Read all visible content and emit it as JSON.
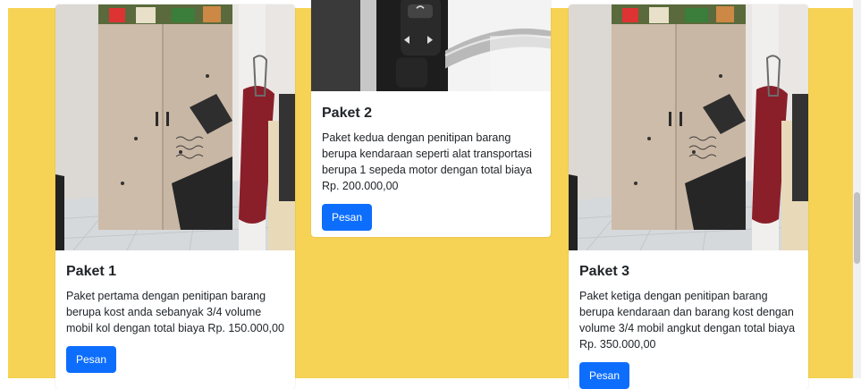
{
  "cards": [
    {
      "title": "Paket 1",
      "text": "Paket pertama dengan penitipan barang berupa kost anda sebanyak 3/4 volume mobil kol dengan total biaya Rp. 150.000,00",
      "button": "Pesan",
      "image": "wardrobe-room-photo"
    },
    {
      "title": "Paket 2",
      "text": "Paket kedua dengan penitipan barang berupa kendaraan seperti alat transportasi berupa 1 sepeda motor dengan total biaya Rp. 200.000,00",
      "button": "Pesan",
      "image": "motorcycle-handlebar-photo"
    },
    {
      "title": "Paket 3",
      "text": "Paket ketiga dengan penitipan barang berupa kendaraan dan barang kost dengan volume 3/4 mobil angkut dengan total biaya Rp. 350.000,00",
      "button": "Pesan",
      "image": "wardrobe-room-photo"
    }
  ],
  "colors": {
    "page_background": "#f6d354",
    "button": "#0d6efd"
  }
}
